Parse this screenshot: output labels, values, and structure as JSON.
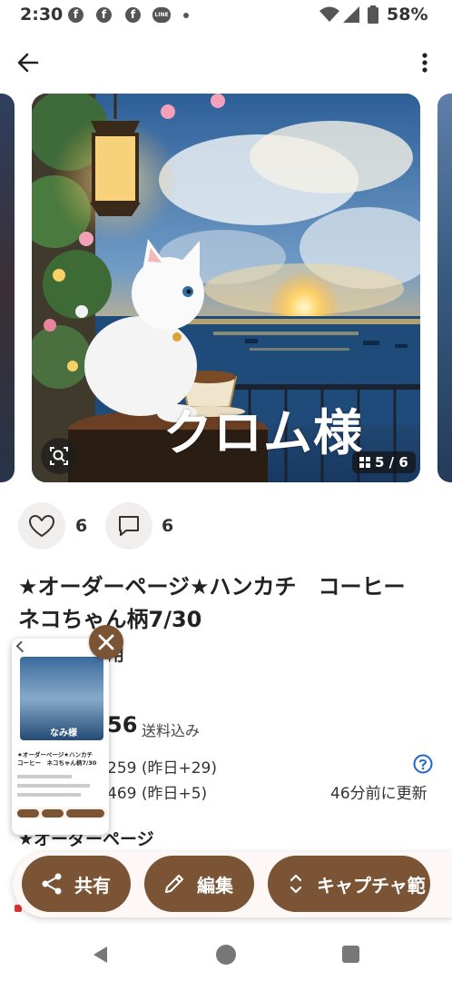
{
  "status_bar": {
    "time": "2:30",
    "notification_icons": [
      "facebook-icon",
      "facebook-icon",
      "facebook-icon",
      "line-icon"
    ],
    "line_badge": "LINE",
    "battery": "58%"
  },
  "gallery": {
    "overlay_text": "クロム様",
    "counter": "5 / 6"
  },
  "reactions": {
    "likes": "6",
    "comments": "6"
  },
  "item": {
    "title": "★オーダーページ★ハンカチ　コーヒー　ネコちゃん柄7/30",
    "subtitle_visible": "用",
    "price_visible": "56",
    "price_note": "送料込み",
    "stat_views_visible": "259 (昨日+29)",
    "stat_favs_visible": "469 (昨日+5)",
    "updated": "46分前に更新",
    "section_label_visible": "★オーダーページ"
  },
  "thumbnail": {
    "overlay_text": "なみ様",
    "title_text": "★オーダーページ★ハンカチ　コーヒー　ネコちゃん柄7/30"
  },
  "actions": {
    "share": "共有",
    "edit": "編集",
    "capture": "キャプチャ範"
  },
  "colors": {
    "accent_brown": "#7b5436",
    "help_blue": "#1e66c8"
  }
}
